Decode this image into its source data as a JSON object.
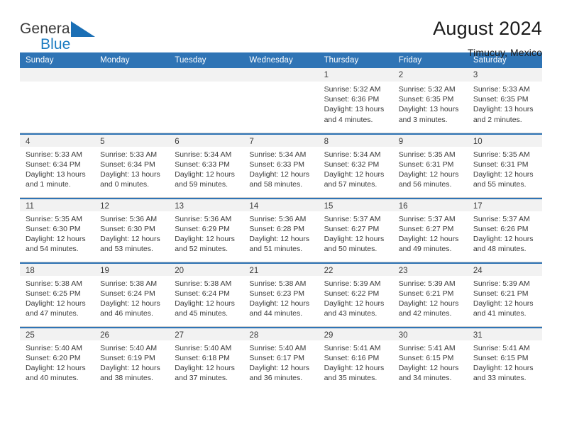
{
  "logo": {
    "primary_text": "General",
    "secondary_text": "Blue",
    "icon": "triangle-logo-icon",
    "accent_color": "#1b7bc1"
  },
  "header": {
    "title": "August 2024",
    "subtitle": "Timucuy, Mexico"
  },
  "theme": {
    "header_bg": "#2f74b5",
    "daynum_bg": "#f2f2f2",
    "grid_line": "#d0d0d0",
    "text": "#3a3a3a"
  },
  "weekday_headers": [
    "Sunday",
    "Monday",
    "Tuesday",
    "Wednesday",
    "Thursday",
    "Friday",
    "Saturday"
  ],
  "weeks": [
    [
      {
        "day": "",
        "empty": true,
        "sunrise": "",
        "sunset": "",
        "daylight": ""
      },
      {
        "day": "",
        "empty": true,
        "sunrise": "",
        "sunset": "",
        "daylight": ""
      },
      {
        "day": "",
        "empty": true,
        "sunrise": "",
        "sunset": "",
        "daylight": ""
      },
      {
        "day": "",
        "empty": true,
        "sunrise": "",
        "sunset": "",
        "daylight": ""
      },
      {
        "day": "1",
        "sunrise": "Sunrise: 5:32 AM",
        "sunset": "Sunset: 6:36 PM",
        "daylight": "Daylight: 13 hours and 4 minutes."
      },
      {
        "day": "2",
        "sunrise": "Sunrise: 5:32 AM",
        "sunset": "Sunset: 6:35 PM",
        "daylight": "Daylight: 13 hours and 3 minutes."
      },
      {
        "day": "3",
        "sunrise": "Sunrise: 5:33 AM",
        "sunset": "Sunset: 6:35 PM",
        "daylight": "Daylight: 13 hours and 2 minutes."
      }
    ],
    [
      {
        "day": "4",
        "sunrise": "Sunrise: 5:33 AM",
        "sunset": "Sunset: 6:34 PM",
        "daylight": "Daylight: 13 hours and 1 minute."
      },
      {
        "day": "5",
        "sunrise": "Sunrise: 5:33 AM",
        "sunset": "Sunset: 6:34 PM",
        "daylight": "Daylight: 13 hours and 0 minutes."
      },
      {
        "day": "6",
        "sunrise": "Sunrise: 5:34 AM",
        "sunset": "Sunset: 6:33 PM",
        "daylight": "Daylight: 12 hours and 59 minutes."
      },
      {
        "day": "7",
        "sunrise": "Sunrise: 5:34 AM",
        "sunset": "Sunset: 6:33 PM",
        "daylight": "Daylight: 12 hours and 58 minutes."
      },
      {
        "day": "8",
        "sunrise": "Sunrise: 5:34 AM",
        "sunset": "Sunset: 6:32 PM",
        "daylight": "Daylight: 12 hours and 57 minutes."
      },
      {
        "day": "9",
        "sunrise": "Sunrise: 5:35 AM",
        "sunset": "Sunset: 6:31 PM",
        "daylight": "Daylight: 12 hours and 56 minutes."
      },
      {
        "day": "10",
        "sunrise": "Sunrise: 5:35 AM",
        "sunset": "Sunset: 6:31 PM",
        "daylight": "Daylight: 12 hours and 55 minutes."
      }
    ],
    [
      {
        "day": "11",
        "sunrise": "Sunrise: 5:35 AM",
        "sunset": "Sunset: 6:30 PM",
        "daylight": "Daylight: 12 hours and 54 minutes."
      },
      {
        "day": "12",
        "sunrise": "Sunrise: 5:36 AM",
        "sunset": "Sunset: 6:30 PM",
        "daylight": "Daylight: 12 hours and 53 minutes."
      },
      {
        "day": "13",
        "sunrise": "Sunrise: 5:36 AM",
        "sunset": "Sunset: 6:29 PM",
        "daylight": "Daylight: 12 hours and 52 minutes."
      },
      {
        "day": "14",
        "sunrise": "Sunrise: 5:36 AM",
        "sunset": "Sunset: 6:28 PM",
        "daylight": "Daylight: 12 hours and 51 minutes."
      },
      {
        "day": "15",
        "sunrise": "Sunrise: 5:37 AM",
        "sunset": "Sunset: 6:27 PM",
        "daylight": "Daylight: 12 hours and 50 minutes."
      },
      {
        "day": "16",
        "sunrise": "Sunrise: 5:37 AM",
        "sunset": "Sunset: 6:27 PM",
        "daylight": "Daylight: 12 hours and 49 minutes."
      },
      {
        "day": "17",
        "sunrise": "Sunrise: 5:37 AM",
        "sunset": "Sunset: 6:26 PM",
        "daylight": "Daylight: 12 hours and 48 minutes."
      }
    ],
    [
      {
        "day": "18",
        "sunrise": "Sunrise: 5:38 AM",
        "sunset": "Sunset: 6:25 PM",
        "daylight": "Daylight: 12 hours and 47 minutes."
      },
      {
        "day": "19",
        "sunrise": "Sunrise: 5:38 AM",
        "sunset": "Sunset: 6:24 PM",
        "daylight": "Daylight: 12 hours and 46 minutes."
      },
      {
        "day": "20",
        "sunrise": "Sunrise: 5:38 AM",
        "sunset": "Sunset: 6:24 PM",
        "daylight": "Daylight: 12 hours and 45 minutes."
      },
      {
        "day": "21",
        "sunrise": "Sunrise: 5:38 AM",
        "sunset": "Sunset: 6:23 PM",
        "daylight": "Daylight: 12 hours and 44 minutes."
      },
      {
        "day": "22",
        "sunrise": "Sunrise: 5:39 AM",
        "sunset": "Sunset: 6:22 PM",
        "daylight": "Daylight: 12 hours and 43 minutes."
      },
      {
        "day": "23",
        "sunrise": "Sunrise: 5:39 AM",
        "sunset": "Sunset: 6:21 PM",
        "daylight": "Daylight: 12 hours and 42 minutes."
      },
      {
        "day": "24",
        "sunrise": "Sunrise: 5:39 AM",
        "sunset": "Sunset: 6:21 PM",
        "daylight": "Daylight: 12 hours and 41 minutes."
      }
    ],
    [
      {
        "day": "25",
        "sunrise": "Sunrise: 5:40 AM",
        "sunset": "Sunset: 6:20 PM",
        "daylight": "Daylight: 12 hours and 40 minutes."
      },
      {
        "day": "26",
        "sunrise": "Sunrise: 5:40 AM",
        "sunset": "Sunset: 6:19 PM",
        "daylight": "Daylight: 12 hours and 38 minutes."
      },
      {
        "day": "27",
        "sunrise": "Sunrise: 5:40 AM",
        "sunset": "Sunset: 6:18 PM",
        "daylight": "Daylight: 12 hours and 37 minutes."
      },
      {
        "day": "28",
        "sunrise": "Sunrise: 5:40 AM",
        "sunset": "Sunset: 6:17 PM",
        "daylight": "Daylight: 12 hours and 36 minutes."
      },
      {
        "day": "29",
        "sunrise": "Sunrise: 5:41 AM",
        "sunset": "Sunset: 6:16 PM",
        "daylight": "Daylight: 12 hours and 35 minutes."
      },
      {
        "day": "30",
        "sunrise": "Sunrise: 5:41 AM",
        "sunset": "Sunset: 6:15 PM",
        "daylight": "Daylight: 12 hours and 34 minutes."
      },
      {
        "day": "31",
        "sunrise": "Sunrise: 5:41 AM",
        "sunset": "Sunset: 6:15 PM",
        "daylight": "Daylight: 12 hours and 33 minutes."
      }
    ]
  ]
}
